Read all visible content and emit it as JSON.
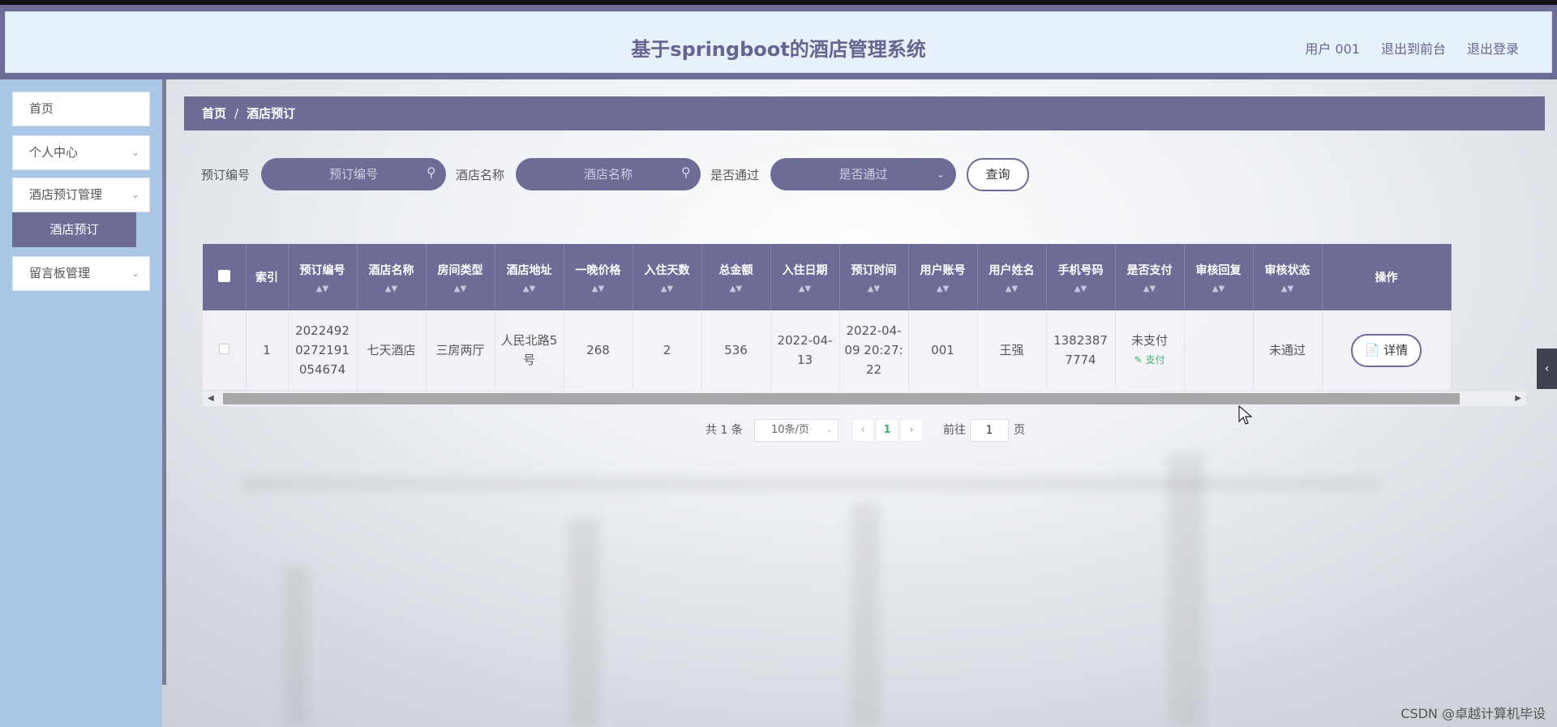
{
  "header": {
    "title": "基于springboot的酒店管理系统",
    "user": "用户 001",
    "to_front": "退出到前台",
    "logout": "退出登录"
  },
  "sidebar": {
    "items": [
      {
        "label": "首页"
      },
      {
        "label": "个人中心"
      },
      {
        "label": "酒店预订管理"
      },
      {
        "label": "留言板管理"
      }
    ],
    "active_sub": "酒店预订"
  },
  "breadcrumb": {
    "home": "首页",
    "sep": "/",
    "current": "酒店预订"
  },
  "search": {
    "order_no_label": "预订编号",
    "order_no_placeholder": "预订编号",
    "hotel_label": "酒店名称",
    "hotel_placeholder": "酒店名称",
    "approved_label": "是否通过",
    "approved_placeholder": "是否通过",
    "query_button": "查询"
  },
  "table": {
    "columns": [
      "索引",
      "预订编号",
      "酒店名称",
      "房间类型",
      "酒店地址",
      "一晚价格",
      "入住天数",
      "总金额",
      "入住日期",
      "预订时间",
      "用户账号",
      "用户姓名",
      "手机号码",
      "是否支付",
      "审核回复",
      "审核状态",
      "操作"
    ],
    "rows": [
      {
        "index": "1",
        "order_no": "20224920272191054674",
        "hotel": "七天酒店",
        "room_type": "三房两厅",
        "address": "人民北路5号",
        "price": "268",
        "days": "2",
        "total": "536",
        "checkin_date": "2022-04-13",
        "booking_time": "2022-04-09 20:27:22",
        "account": "001",
        "name": "王强",
        "phone": "13823877774",
        "paid": "未支付",
        "pay_link": "支付",
        "reply": "",
        "status": "未通过",
        "detail_button": "详情"
      }
    ]
  },
  "pagination": {
    "total": "共 1 条",
    "page_size": "10条/页",
    "current_page": "1",
    "goto_label": "前往",
    "goto_value": "1",
    "page_suffix": "页"
  },
  "watermark": "CSDN @卓越计算机毕设"
}
